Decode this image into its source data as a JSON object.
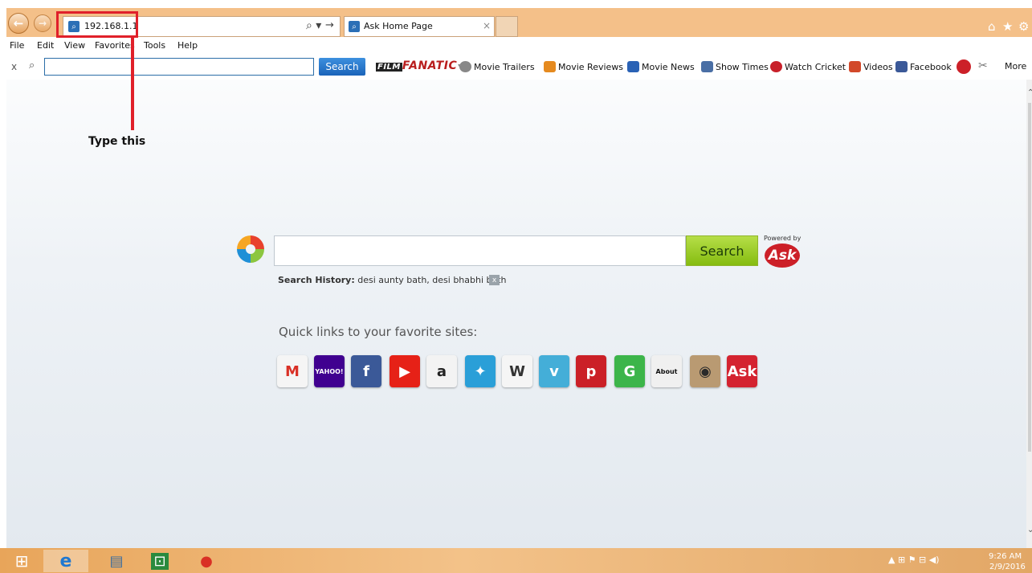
{
  "browser": {
    "address_value": "192.168.1.1",
    "tab_title": "Ask Home Page",
    "tab_close": "×",
    "addr_search_glyph": "⌕ ▾",
    "addr_go_glyph": "→",
    "back_glyph": "←",
    "forward_glyph": "→",
    "home_glyph": "⌂",
    "fav_glyph": "★",
    "settings_glyph": "⚙"
  },
  "annotation": {
    "text": "Type this"
  },
  "menu": [
    "File",
    "Edit",
    "View",
    "Favorites",
    "Tools",
    "Help"
  ],
  "toolbar": {
    "close_glyph": "x",
    "search_glyph": "⌕",
    "search_label": "Search",
    "logo_film": "FILM",
    "logo_fanatic": "FANATIC",
    "logo_tm": "™",
    "links": [
      {
        "label": "Movie Trailers",
        "color": "#888888"
      },
      {
        "label": "Movie Reviews",
        "color": "#e58a1f"
      },
      {
        "label": "Movie News",
        "color": "#2a62b5"
      },
      {
        "label": "Show Times",
        "color": "#4a6fa5"
      },
      {
        "label": "Watch Cricket",
        "color": "#c8202a"
      },
      {
        "label": "Videos",
        "color": "#d2492a"
      },
      {
        "label": "Facebook",
        "color": "#3b5998"
      }
    ],
    "more_label": "More"
  },
  "search": {
    "button_label": "Search",
    "powered_by": "Powered by",
    "ask_logo": "Ask",
    "history_label": "Search History:",
    "history_value": "desi aunty bath, desi bhabhi bath",
    "history_clear": "x"
  },
  "quick_links": {
    "title": "Quick links to your favorite sites:",
    "items": [
      {
        "name": "gmail",
        "glyph": "M",
        "bg": "#f5f5f5",
        "fg": "#d93025"
      },
      {
        "name": "yahoo",
        "glyph": "YAHOO!",
        "bg": "#400090",
        "fg": "#ffffff"
      },
      {
        "name": "facebook",
        "glyph": "f",
        "bg": "#3b5998",
        "fg": "#ffffff"
      },
      {
        "name": "youtube",
        "glyph": "▶",
        "bg": "#e62117",
        "fg": "#ffffff"
      },
      {
        "name": "amazon",
        "glyph": "a",
        "bg": "#f3f3f3",
        "fg": "#222222"
      },
      {
        "name": "twitter",
        "glyph": "✦",
        "bg": "#2a9fd8",
        "fg": "#ffffff"
      },
      {
        "name": "wikipedia",
        "glyph": "W",
        "bg": "#f5f5f5",
        "fg": "#333333"
      },
      {
        "name": "vimeo",
        "glyph": "v",
        "bg": "#44aed8",
        "fg": "#ffffff"
      },
      {
        "name": "pinterest",
        "glyph": "p",
        "bg": "#cb2027",
        "fg": "#ffffff"
      },
      {
        "name": "grammarly",
        "glyph": "G",
        "bg": "#3cb54a",
        "fg": "#ffffff"
      },
      {
        "name": "about",
        "glyph": "About",
        "bg": "#f0f0f0",
        "fg": "#111111"
      },
      {
        "name": "instagram",
        "glyph": "◉",
        "bg": "#b99a72",
        "fg": "#2a2a2a"
      },
      {
        "name": "ask",
        "glyph": "Ask",
        "bg": "#d42330",
        "fg": "#ffffff"
      }
    ]
  },
  "taskbar": {
    "start_glyph": "⊞",
    "ie_glyph": "e",
    "explorer_glyph": "▤",
    "store_glyph": "⊡",
    "chrome_glyph": "●",
    "tray_glyphs": "▲  ⊞  ⚑  ⊟  ◀)",
    "time": "9:26 AM",
    "date": "2/9/2016"
  }
}
